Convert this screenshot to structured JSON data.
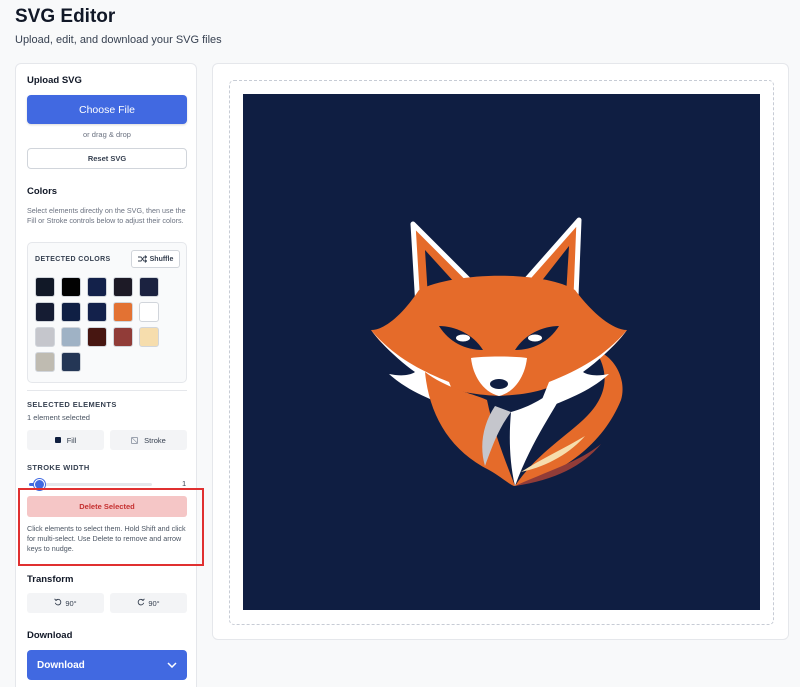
{
  "header": {
    "title": "SVG Editor",
    "subtitle": "Upload, edit, and download your SVG files"
  },
  "sidebar": {
    "upload": {
      "title": "Upload SVG",
      "choose_label": "Choose File",
      "drag_hint": "or drag & drop",
      "reset_label": "Reset SVG"
    },
    "colors": {
      "title": "Colors",
      "description": "Select elements directly on the SVG, then use the Fill or Stroke controls below to adjust their colors.",
      "detected_label": "DETECTED COLORS",
      "shuffle_label": "Shuffle",
      "swatches": [
        "#111827",
        "#020202",
        "#13214a",
        "#1d1a26",
        "#1b2240",
        "#151c33",
        "#0f1f44",
        "#13214b",
        "#e37233",
        "#ffffff",
        "#c5c6cc",
        "#9fb2c5",
        "#471611",
        "#913c38",
        "#f6ddad",
        "#bfbbb1",
        "#243655"
      ]
    },
    "selected": {
      "title": "SELECTED ELEMENTS",
      "count_text": "1 element selected",
      "fill_label": "Fill",
      "stroke_label": "Stroke"
    },
    "stroke_width": {
      "title": "STROKE WIDTH",
      "value": "1",
      "slider_fraction": 0.06
    },
    "delete": {
      "label": "Delete Selected",
      "help": "Click elements to select them. Hold Shift and click for multi-select. Use Delete to remove and arrow keys to nudge."
    },
    "transform": {
      "title": "Transform",
      "rotate_left_label": "90°",
      "rotate_right_label": "90°"
    },
    "download": {
      "title": "Download",
      "button_label": "Download"
    }
  },
  "canvas": {
    "background": "#0f1e42",
    "fox_orange": "#e56b2a",
    "fox_dark_orange": "#c9521d"
  },
  "colors": {
    "accent": "#4169e1",
    "danger_bg": "#f5c6c6",
    "danger_text": "#c53030",
    "highlight": "#e03030"
  }
}
